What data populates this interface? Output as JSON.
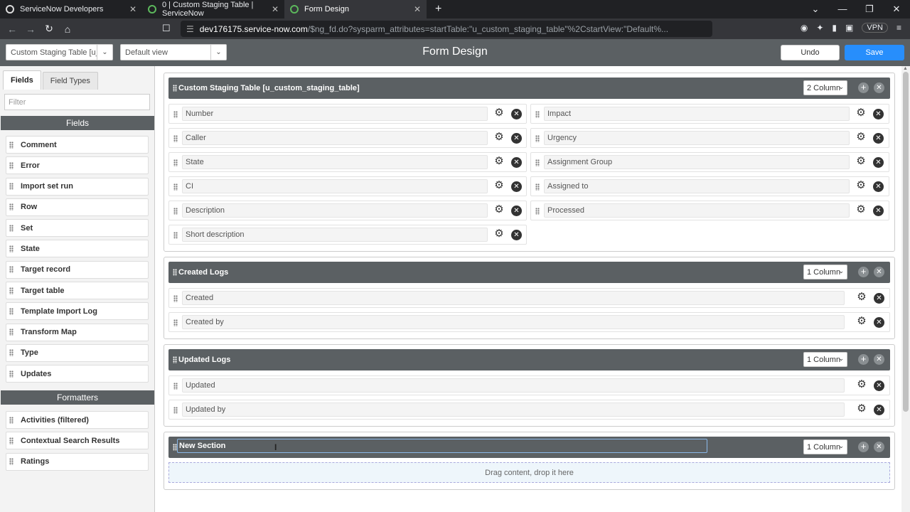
{
  "browser": {
    "tabs": [
      {
        "title": "ServiceNow Developers"
      },
      {
        "title": "0 | Custom Staging Table | ServiceNow"
      },
      {
        "title": "Form Design"
      }
    ],
    "url_host": "dev176175.service-now.com",
    "url_path": "/$ng_fd.do?sysparm_attributes=startTable:\"u_custom_staging_table\"%2CstartView:\"Default%...",
    "vpn_label": "VPN"
  },
  "header": {
    "table_select": "Custom Staging Table [u_c",
    "view_select": "Default view",
    "title": "Form Design",
    "undo_label": "Undo",
    "save_label": "Save"
  },
  "palette": {
    "tabs": [
      "Fields",
      "Field Types"
    ],
    "filter_placeholder": "Filter",
    "fields_heading": "Fields",
    "fields": [
      "Comment",
      "Error",
      "Import set run",
      "Row",
      "Set",
      "State",
      "Target record",
      "Target table",
      "Template Import Log",
      "Transform Map",
      "Type",
      "Updates"
    ],
    "formatters_heading": "Formatters",
    "formatters": [
      "Activities (filtered)",
      "Contextual Search Results",
      "Ratings"
    ]
  },
  "sections": [
    {
      "title": "Custom Staging Table [u_custom_staging_table]",
      "columns": "2 Column",
      "left": [
        "Number",
        "Caller",
        "State",
        "CI",
        "Description",
        "Short description"
      ],
      "right": [
        "Impact",
        "Urgency",
        "Assignment Group",
        "Assigned to",
        "Processed"
      ]
    },
    {
      "title": "Created Logs",
      "columns": "1 Column",
      "fields": [
        "Created",
        "Created by"
      ]
    },
    {
      "title": "Updated Logs",
      "columns": "1 Column",
      "fields": [
        "Updated",
        "Updated by"
      ]
    },
    {
      "title": "New Section",
      "columns": "1 Column",
      "dropzone": "Drag content, drop it here"
    }
  ]
}
